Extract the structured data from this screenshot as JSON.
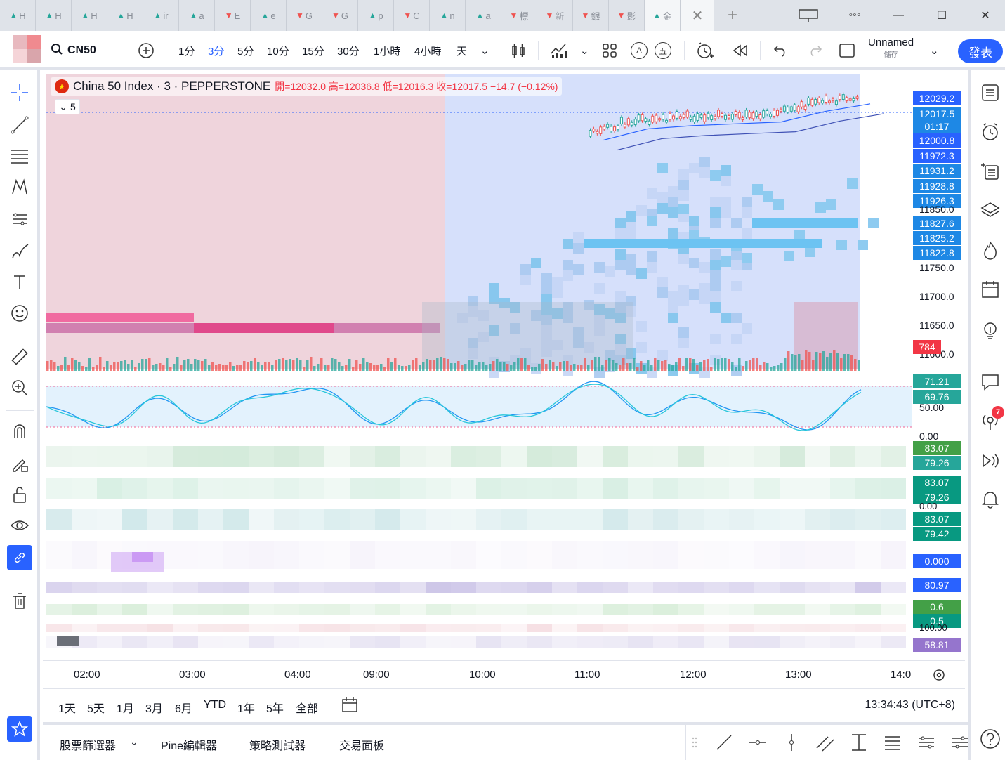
{
  "browser": {
    "tabs": [
      {
        "dir": "up",
        "text": "H"
      },
      {
        "dir": "up",
        "text": "H"
      },
      {
        "dir": "up",
        "text": "H"
      },
      {
        "dir": "up",
        "text": "H"
      },
      {
        "dir": "up",
        "text": "ir"
      },
      {
        "dir": "up",
        "text": "a"
      },
      {
        "dir": "down",
        "text": "E"
      },
      {
        "dir": "up",
        "text": "e"
      },
      {
        "dir": "down",
        "text": "G"
      },
      {
        "dir": "down",
        "text": "G"
      },
      {
        "dir": "up",
        "text": "p"
      },
      {
        "dir": "down",
        "text": "C"
      },
      {
        "dir": "up",
        "text": "n"
      },
      {
        "dir": "up",
        "text": "a"
      },
      {
        "dir": "down",
        "text": "標"
      },
      {
        "dir": "down",
        "text": "新"
      },
      {
        "dir": "down",
        "text": "銀"
      },
      {
        "dir": "down",
        "text": "影"
      },
      {
        "dir": "up",
        "text": "金"
      }
    ],
    "up_glyph": "▲",
    "down_glyph": "▼"
  },
  "toolbar": {
    "symbol": "CN50",
    "intervals": [
      "1分",
      "3分",
      "5分",
      "10分",
      "15分",
      "30分",
      "1小時",
      "4小時",
      "天"
    ],
    "active_interval": "3分",
    "layout_name": "Unnamed",
    "layout_status": "儲存",
    "publish_label": "發表",
    "indicator_a": "A",
    "indicator_b": "五"
  },
  "legend": {
    "title": "China 50 Index · 3 · PEPPERSTONE",
    "ohlc": "開=12032.0  高=12036.8  低=12016.3  收=12017.5  −14.7 (−0.12%)",
    "collapse_count": "5"
  },
  "price_tags": [
    {
      "value": "12029.2",
      "style": "blue"
    },
    {
      "value": "12017.5",
      "style": "blue2"
    },
    {
      "value": "01:17",
      "style": "blue2"
    },
    {
      "value": "12000.8",
      "style": "blue"
    },
    {
      "value": "11972.3",
      "style": "blue"
    },
    {
      "value": "11931.2",
      "style": "blue2"
    },
    {
      "value": "11928.8",
      "style": "blue2"
    },
    {
      "value": "11926.3",
      "style": "blue2"
    },
    {
      "value": "11827.6",
      "style": "blue2"
    },
    {
      "value": "11825.2",
      "style": "blue2"
    },
    {
      "value": "11822.8",
      "style": "blue2"
    }
  ],
  "price_axis": [
    "11850.0",
    "11750.0",
    "11700.0",
    "11650.0",
    "11600.0"
  ],
  "volume_tag": "784",
  "indicator_axis": {
    "stoch_tags": [
      "71.21",
      "69.76"
    ],
    "stoch_levels": [
      "50.00",
      "0.00"
    ],
    "ind_tags": [
      {
        "value": "83.07",
        "style": "green"
      },
      {
        "value": "79.26",
        "style": "green2"
      },
      {
        "value": "83.07",
        "style": "teal"
      },
      {
        "value": "79.26",
        "style": "teal"
      },
      {
        "value": "83.07",
        "style": "teal"
      },
      {
        "value": "79.42",
        "style": "teal"
      },
      {
        "value": "0.000",
        "style": "ind"
      },
      {
        "value": "80.97",
        "style": "ind"
      },
      {
        "value": "0.6",
        "style": "green"
      },
      {
        "value": "0.5",
        "style": "teal"
      },
      {
        "value": "58.81",
        "style": "purple"
      }
    ],
    "small_labels": [
      "0.00",
      "100.00"
    ]
  },
  "time_axis": [
    "02:00",
    "03:00",
    "04:00",
    "09:00",
    "10:00",
    "11:00",
    "12:00",
    "13:00",
    "14:0"
  ],
  "ranges": [
    "1天",
    "5天",
    "1月",
    "3月",
    "6月",
    "YTD",
    "1年",
    "5年",
    "全部"
  ],
  "clock": "13:34:43 (UTC+8)",
  "bottom_tabs": [
    "股票篩選器",
    "Pine編輯器",
    "策略測試器",
    "交易面板"
  ],
  "notification_count": "7",
  "chart_data": {
    "type": "line",
    "candles": [
      {
        "time": "11:00",
        "close": 11972.3
      },
      {
        "time": "11:30",
        "close": 11990.0
      },
      {
        "time": "12:00",
        "close": 11995.0
      },
      {
        "time": "12:30",
        "close": 11998.0
      },
      {
        "time": "13:00",
        "close": 12000.8
      },
      {
        "time": "13:20",
        "close": 12017.5
      },
      {
        "time": "13:30",
        "close": 12029.2
      }
    ],
    "ylim": [
      11600,
      12040
    ]
  },
  "colors": {
    "accent": "#2962ff",
    "up": "#26a69a",
    "down": "#f23645"
  }
}
